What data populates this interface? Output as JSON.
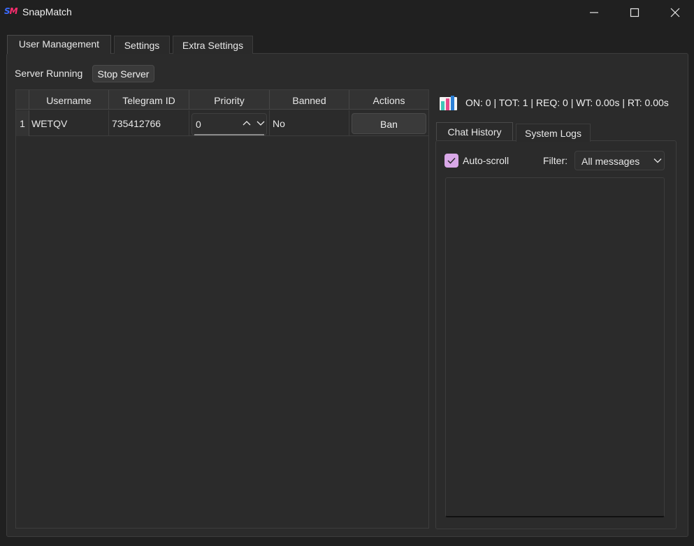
{
  "window": {
    "title": "SnapMatch",
    "logo_text": {
      "s": "S",
      "m": "M"
    }
  },
  "tabs": [
    {
      "label": "User Management",
      "active": true
    },
    {
      "label": "Settings",
      "active": false
    },
    {
      "label": "Extra Settings",
      "active": false
    }
  ],
  "server": {
    "status": "Server Running",
    "toggle_label": "Stop Server"
  },
  "table": {
    "headers": [
      "Username",
      "Telegram ID",
      "Priority",
      "Banned",
      "Actions"
    ],
    "rows": [
      {
        "index": "1",
        "username": "WETQV",
        "telegram_id": "735412766",
        "priority": "0",
        "banned": "No",
        "action": "Ban"
      }
    ]
  },
  "stats": {
    "text": "ON: 0 | TOT: 1 | REQ: 0 | WT: 0.00s | RT: 0.00s",
    "icon": "bar-chart-icon"
  },
  "subtabs": [
    {
      "label": "Chat History",
      "active": true
    },
    {
      "label": "System Logs",
      "active": false
    }
  ],
  "log_controls": {
    "autoscroll_label": "Auto-scroll",
    "autoscroll_checked": true,
    "filter_label": "Filter:",
    "filter_value": "All messages"
  },
  "colors": {
    "accent_checkbox": "#d9a8e8",
    "background": "#202020",
    "panel": "#2b2b2b"
  }
}
